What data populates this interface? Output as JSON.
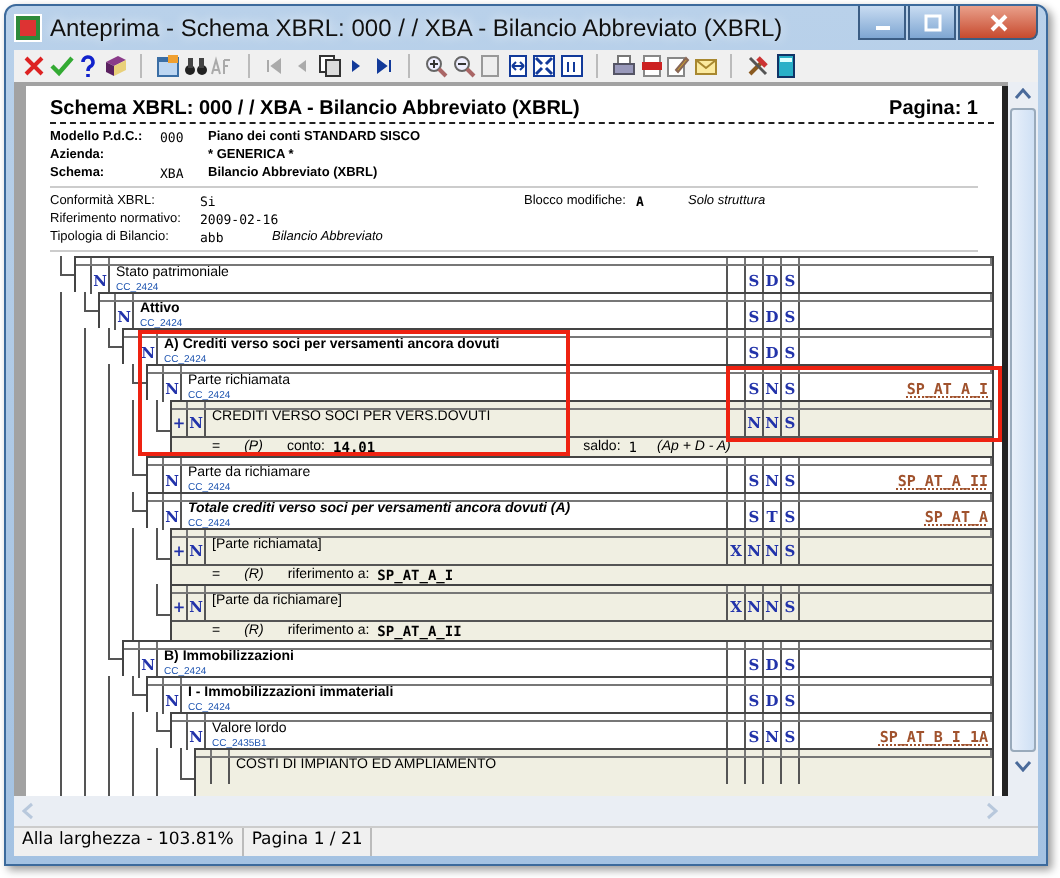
{
  "window": {
    "title": "Anteprima - Schema XBRL: 000 / / XBA  - Bilancio Abbreviato (XBRL)"
  },
  "report": {
    "title": "Schema XBRL: 000 / / XBA  - Bilancio Abbreviato (XBRL)",
    "page": "Pagina: 1",
    "info_main": [
      {
        "label": "Modello P.d.C.:",
        "code": "000",
        "value": "Piano dei conti STANDARD SISCO"
      },
      {
        "label": "Azienda:",
        "value": "* GENERICA *"
      },
      {
        "label": "Schema:",
        "code": "XBA",
        "value": "Bilancio Abbreviato (XBRL)"
      }
    ],
    "info_extra": [
      {
        "label": "Conformità XBRL:",
        "code": "Si",
        "side_label": "Blocco modifiche:",
        "side_code": "A",
        "side_value": "Solo struttura"
      },
      {
        "label": "Riferimento normativo:",
        "code": "2009-02-16"
      },
      {
        "label": "Tipologia di Bilancio:",
        "code": "abb",
        "value": "Bilancio Abbreviato"
      }
    ],
    "tree": [
      {
        "kind": "group",
        "title": "Stato patrimoniale",
        "bold": false,
        "italic": false,
        "n": "N",
        "code": "CC_2424",
        "sta": "S",
        "spc": "D",
        "nc": "S",
        "children": [
          {
            "kind": "group",
            "title": "Attivo",
            "bold": true,
            "italic": false,
            "n": "N",
            "code": "CC_2424",
            "sta": "S",
            "spc": "D",
            "nc": "S",
            "children": [
              {
                "kind": "group",
                "title": "A) Crediti verso soci per versamenti ancora dovuti",
                "bold": true,
                "italic": false,
                "n": "N",
                "code": "CC_2424",
                "sta": "S",
                "spc": "D",
                "nc": "S",
                "children": [
                  {
                    "kind": "group",
                    "title": "Parte richiamata",
                    "bold": false,
                    "italic": false,
                    "n": "N",
                    "code": "CC_2424",
                    "sta": "S",
                    "spc": "N",
                    "nc": "S",
                    "ref": "SP_AT_A_I",
                    "children": [
                      {
                        "kind": "account",
                        "sign": "+",
                        "n": "N",
                        "title": "CREDITI VERSO SOCI PER VERS.DOVUTI",
                        "sta": "N",
                        "spc": "N",
                        "nc": "S",
                        "formula": {
                          "eq": "=",
                          "type": "(P)",
                          "label": "conto:",
                          "value": "14.01",
                          "saldo_label": "saldo:",
                          "saldo": "1",
                          "saldo_rule": "(Ap + D - A)"
                        }
                      }
                    ]
                  },
                  {
                    "kind": "group",
                    "title": "Parte da richiamare",
                    "bold": false,
                    "italic": false,
                    "n": "N",
                    "code": "CC_2424",
                    "sta": "S",
                    "spc": "N",
                    "nc": "S",
                    "ref": "SP_AT_A_II"
                  },
                  {
                    "kind": "group",
                    "title": "Totale crediti verso soci per versamenti ancora dovuti (A)",
                    "bold": true,
                    "italic": true,
                    "n": "N",
                    "code": "CC_2424",
                    "sta": "S",
                    "spc": "T",
                    "nc": "S",
                    "ref": "SP_AT_A",
                    "children": [
                      {
                        "kind": "account",
                        "sign": "+",
                        "n": "N",
                        "title": "[Parte richiamata]",
                        "ric": "X",
                        "sta": "N",
                        "spc": "N",
                        "nc": "S",
                        "formula": {
                          "eq": "=",
                          "type": "(R)",
                          "label": "riferimento a:",
                          "value": "SP_AT_A_I"
                        }
                      },
                      {
                        "kind": "account",
                        "sign": "+",
                        "n": "N",
                        "title": "[Parte da richiamare]",
                        "ric": "X",
                        "sta": "N",
                        "spc": "N",
                        "nc": "S",
                        "formula": {
                          "eq": "=",
                          "type": "(R)",
                          "label": "riferimento a:",
                          "value": "SP_AT_A_II"
                        }
                      }
                    ]
                  }
                ]
              },
              {
                "kind": "group",
                "title": "B) Immobilizzazioni",
                "bold": true,
                "italic": false,
                "n": "N",
                "code": "CC_2424",
                "sta": "S",
                "spc": "D",
                "nc": "S",
                "children": [
                  {
                    "kind": "group",
                    "title": "I - Immobilizzazioni immateriali",
                    "bold": true,
                    "italic": false,
                    "n": "N",
                    "code": "CC_2424",
                    "sta": "S",
                    "spc": "D",
                    "nc": "S",
                    "children": [
                      {
                        "kind": "group",
                        "title": "Valore lordo",
                        "bold": false,
                        "italic": false,
                        "n": "N",
                        "code": "CC_2435B1",
                        "sta": "S",
                        "spc": "N",
                        "nc": "S",
                        "ref": "SP_AT_B_I_1A",
                        "children": [
                          {
                            "kind": "account",
                            "title": "COSTI DI IMPIANTO ED AMPLIAMENTO"
                          }
                        ]
                      }
                    ]
                  }
                ]
              }
            ]
          }
        ]
      }
    ]
  },
  "status_bar": {
    "zoom": "Alla larghezza - 103.81%",
    "page": "Pagina 1 / 21"
  }
}
